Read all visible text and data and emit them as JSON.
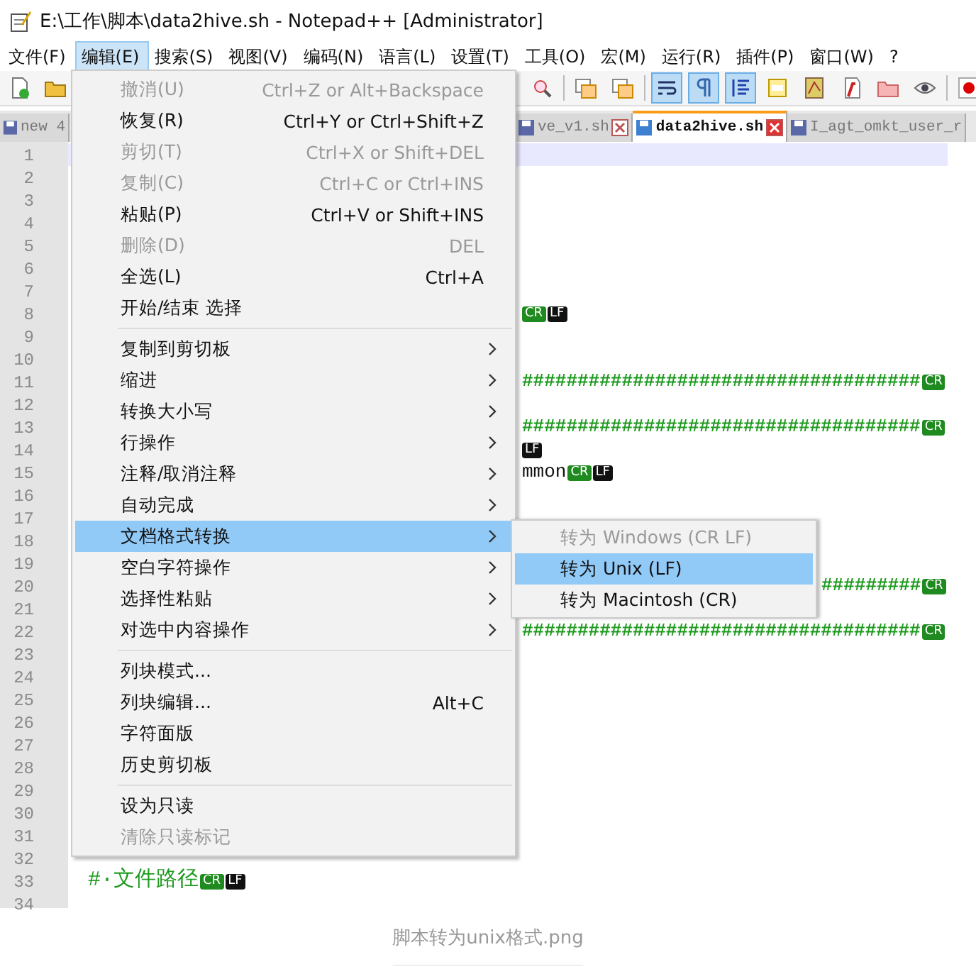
{
  "window": {
    "title": "E:\\工作\\脚本\\data2hive.sh - Notepad++ [Administrator]"
  },
  "menubar": [
    {
      "label": "文件(F)",
      "selected": false
    },
    {
      "label": "编辑(E)",
      "selected": true
    },
    {
      "label": "搜索(S)",
      "selected": false
    },
    {
      "label": "视图(V)",
      "selected": false
    },
    {
      "label": "编码(N)",
      "selected": false
    },
    {
      "label": "语言(L)",
      "selected": false
    },
    {
      "label": "设置(T)",
      "selected": false
    },
    {
      "label": "工具(O)",
      "selected": false
    },
    {
      "label": "宏(M)",
      "selected": false
    },
    {
      "label": "运行(R)",
      "selected": false
    },
    {
      "label": "插件(P)",
      "selected": false
    },
    {
      "label": "窗口(W)",
      "selected": false
    },
    {
      "label": "?",
      "selected": false
    }
  ],
  "toolbar": {
    "left": [
      {
        "kind": "new"
      },
      {
        "kind": "open"
      }
    ],
    "right": [
      {
        "kind": "zoom"
      },
      {
        "kind": "sep"
      },
      {
        "kind": "window"
      },
      {
        "kind": "window"
      },
      {
        "kind": "sep"
      },
      {
        "kind": "wrap",
        "on": true
      },
      {
        "kind": "pilcrow",
        "on": true
      },
      {
        "kind": "indent",
        "on": true
      },
      {
        "kind": "panel"
      },
      {
        "kind": "map"
      },
      {
        "kind": "function"
      },
      {
        "kind": "folder"
      },
      {
        "kind": "eye"
      },
      {
        "kind": "sep"
      },
      {
        "kind": "record"
      }
    ]
  },
  "tabs": [
    {
      "label": "new 4",
      "selected": false,
      "closable": false
    },
    {
      "label": "ve_v1.sh",
      "selected": false,
      "closable": true
    },
    {
      "label": "data2hive.sh",
      "selected": true,
      "closable": true
    },
    {
      "label": "I_agt_omkt_user_r",
      "selected": false,
      "closable": false
    }
  ],
  "editor": {
    "lines": [
      {
        "number": "1",
        "current": true
      },
      {
        "number": "2",
        "current": false
      },
      {
        "number": "3",
        "current": false
      },
      {
        "number": "4",
        "current": false
      },
      {
        "number": "5",
        "current": false
      },
      {
        "number": "6",
        "current": false
      },
      {
        "number": "7",
        "current": false
      },
      {
        "number": "8",
        "current": false,
        "kind": "fragment",
        "eol": [
          {
            "text": "CR",
            "kind": "cr"
          },
          {
            "text": "LF",
            "kind": "lf"
          }
        ]
      },
      {
        "number": "9",
        "current": false
      },
      {
        "number": "10",
        "current": false
      },
      {
        "number": "11",
        "current": false,
        "kind": "fragment",
        "text": "####################################",
        "eol": [
          {
            "text": "CR",
            "kind": "cr"
          }
        ]
      },
      {
        "number": "12",
        "current": false
      },
      {
        "number": "13",
        "current": false,
        "kind": "fragment",
        "text": "####################################",
        "eol": [
          {
            "text": "CR",
            "kind": "cr"
          }
        ]
      },
      {
        "number": "14",
        "current": false,
        "kind": "fragment",
        "eol": [
          {
            "text": "LF",
            "kind": "lf"
          }
        ]
      },
      {
        "number": "15",
        "current": false,
        "kind": "fragment",
        "text": "mmon",
        "eol": [
          {
            "text": "CR",
            "kind": "cr"
          },
          {
            "text": "LF",
            "kind": "lf"
          }
        ]
      },
      {
        "number": "16",
        "current": false
      },
      {
        "number": "17",
        "current": false
      },
      {
        "number": "18",
        "current": false
      },
      {
        "number": "19",
        "current": false
      },
      {
        "number": "20",
        "current": false,
        "kind": "after_submenu",
        "text": "#########",
        "eol": [
          {
            "text": "CR",
            "kind": "cr"
          }
        ]
      },
      {
        "number": "21",
        "current": false
      },
      {
        "number": "22",
        "current": false,
        "kind": "fragment",
        "text": "####################################",
        "eol": [
          {
            "text": "CR",
            "kind": "cr"
          }
        ]
      },
      {
        "number": "23",
        "current": false
      },
      {
        "number": "24",
        "current": false
      },
      {
        "number": "25",
        "current": false
      },
      {
        "number": "26",
        "current": false
      },
      {
        "number": "27",
        "current": false
      },
      {
        "number": "28",
        "current": false
      },
      {
        "number": "29",
        "current": false
      },
      {
        "number": "30",
        "current": false
      },
      {
        "number": "31",
        "current": false
      },
      {
        "number": "32",
        "current": false
      },
      {
        "number": "33",
        "current": false,
        "kind": "full",
        "text": "#·文件路径",
        "eol": [
          {
            "text": "CR",
            "kind": "cr"
          },
          {
            "text": "LF",
            "kind": "lf"
          }
        ]
      },
      {
        "number": "34",
        "current": false
      }
    ]
  },
  "edit_menu": {
    "items": [
      {
        "kind": "item",
        "label": "撤消(U)",
        "shortcut": "Ctrl+Z or Alt+Backspace",
        "disabled": true,
        "submenu": false,
        "selected": false
      },
      {
        "kind": "item",
        "label": "恢复(R)",
        "shortcut": "Ctrl+Y or Ctrl+Shift+Z",
        "disabled": false,
        "submenu": false,
        "selected": false
      },
      {
        "kind": "item",
        "label": "剪切(T)",
        "shortcut": "Ctrl+X or Shift+DEL",
        "disabled": true,
        "submenu": false,
        "selected": false
      },
      {
        "kind": "item",
        "label": "复制(C)",
        "shortcut": "Ctrl+C or Ctrl+INS",
        "disabled": true,
        "submenu": false,
        "selected": false
      },
      {
        "kind": "item",
        "label": "粘贴(P)",
        "shortcut": "Ctrl+V or Shift+INS",
        "disabled": false,
        "submenu": false,
        "selected": false
      },
      {
        "kind": "item",
        "label": "删除(D)",
        "shortcut": "DEL",
        "disabled": true,
        "submenu": false,
        "selected": false
      },
      {
        "kind": "item",
        "label": "全选(L)",
        "shortcut": "Ctrl+A",
        "disabled": false,
        "submenu": false,
        "selected": false
      },
      {
        "kind": "item",
        "label": "开始/结束 选择",
        "disabled": false,
        "submenu": false,
        "selected": false
      },
      {
        "kind": "separator"
      },
      {
        "kind": "item",
        "label": "复制到剪切板",
        "disabled": false,
        "submenu": true,
        "selected": false
      },
      {
        "kind": "item",
        "label": "缩进",
        "disabled": false,
        "submenu": true,
        "selected": false
      },
      {
        "kind": "item",
        "label": "转换大小写",
        "disabled": false,
        "submenu": true,
        "selected": false
      },
      {
        "kind": "item",
        "label": "行操作",
        "disabled": false,
        "submenu": true,
        "selected": false
      },
      {
        "kind": "item",
        "label": "注释/取消注释",
        "disabled": false,
        "submenu": true,
        "selected": false
      },
      {
        "kind": "item",
        "label": "自动完成",
        "disabled": false,
        "submenu": true,
        "selected": false
      },
      {
        "kind": "item",
        "label": "文档格式转换",
        "disabled": false,
        "submenu": true,
        "selected": true
      },
      {
        "kind": "item",
        "label": "空白字符操作",
        "disabled": false,
        "submenu": true,
        "selected": false
      },
      {
        "kind": "item",
        "label": "选择性粘贴",
        "disabled": false,
        "submenu": true,
        "selected": false
      },
      {
        "kind": "item",
        "label": "对选中内容操作",
        "disabled": false,
        "submenu": true,
        "selected": false
      },
      {
        "kind": "separator"
      },
      {
        "kind": "item",
        "label": "列块模式...",
        "disabled": false,
        "submenu": false,
        "selected": false
      },
      {
        "kind": "item",
        "label": "列块编辑...",
        "shortcut": "Alt+C",
        "disabled": false,
        "submenu": false,
        "selected": false
      },
      {
        "kind": "item",
        "label": "字符面版",
        "disabled": false,
        "submenu": false,
        "selected": false
      },
      {
        "kind": "item",
        "label": "历史剪切板",
        "disabled": false,
        "submenu": false,
        "selected": false
      },
      {
        "kind": "separator"
      },
      {
        "kind": "item",
        "label": "设为只读",
        "disabled": false,
        "submenu": false,
        "selected": false
      },
      {
        "kind": "item",
        "label": "清除只读标记",
        "disabled": true,
        "submenu": false,
        "selected": false
      }
    ]
  },
  "submenu": {
    "items": [
      {
        "label": "转为 Windows (CR LF)",
        "disabled": true,
        "selected": false
      },
      {
        "label": "转为 Unix (LF)",
        "disabled": false,
        "selected": true
      },
      {
        "label": "转为 Macintosh (CR)",
        "disabled": false,
        "selected": false
      }
    ]
  },
  "caption": "脚本转为unix格式.png"
}
